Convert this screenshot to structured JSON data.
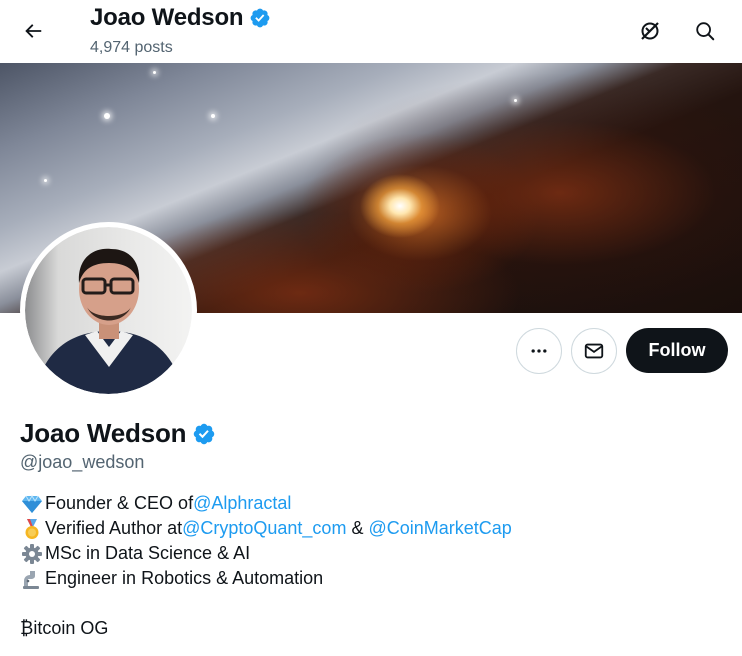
{
  "header": {
    "name": "Joao Wedson",
    "posts_count": "4,974 posts"
  },
  "profile": {
    "display_name": "Joao Wedson",
    "handle": "@joao_wedson",
    "follow_label": "Follow"
  },
  "bio": {
    "line1_text": "Founder & CEO of ",
    "line1_link": "@Alphractal",
    "line2_text": "Verified Author at ",
    "line2_link1": "@CryptoQuant_com",
    "line2_sep": " & ",
    "line2_link2": "@CoinMarketCap",
    "line3_text": "MSc in Data Science & AI",
    "line4_text": "Engineer in Robotics & Automation",
    "line5_text": "₿itcoin OG"
  },
  "icons": {
    "back": "arrow-left-icon",
    "grok": "grok-icon",
    "search": "search-icon",
    "more": "more-icon",
    "message": "mail-icon",
    "verified": "verified-badge-icon",
    "bio_emojis": [
      "gem-emoji",
      "medal-emoji",
      "gear-emoji",
      "mechanical-arm-emoji"
    ]
  },
  "colors": {
    "accent": "#1d9bf0",
    "text": "#0f1419",
    "muted": "#536471",
    "follow_bg": "#0f1419"
  }
}
